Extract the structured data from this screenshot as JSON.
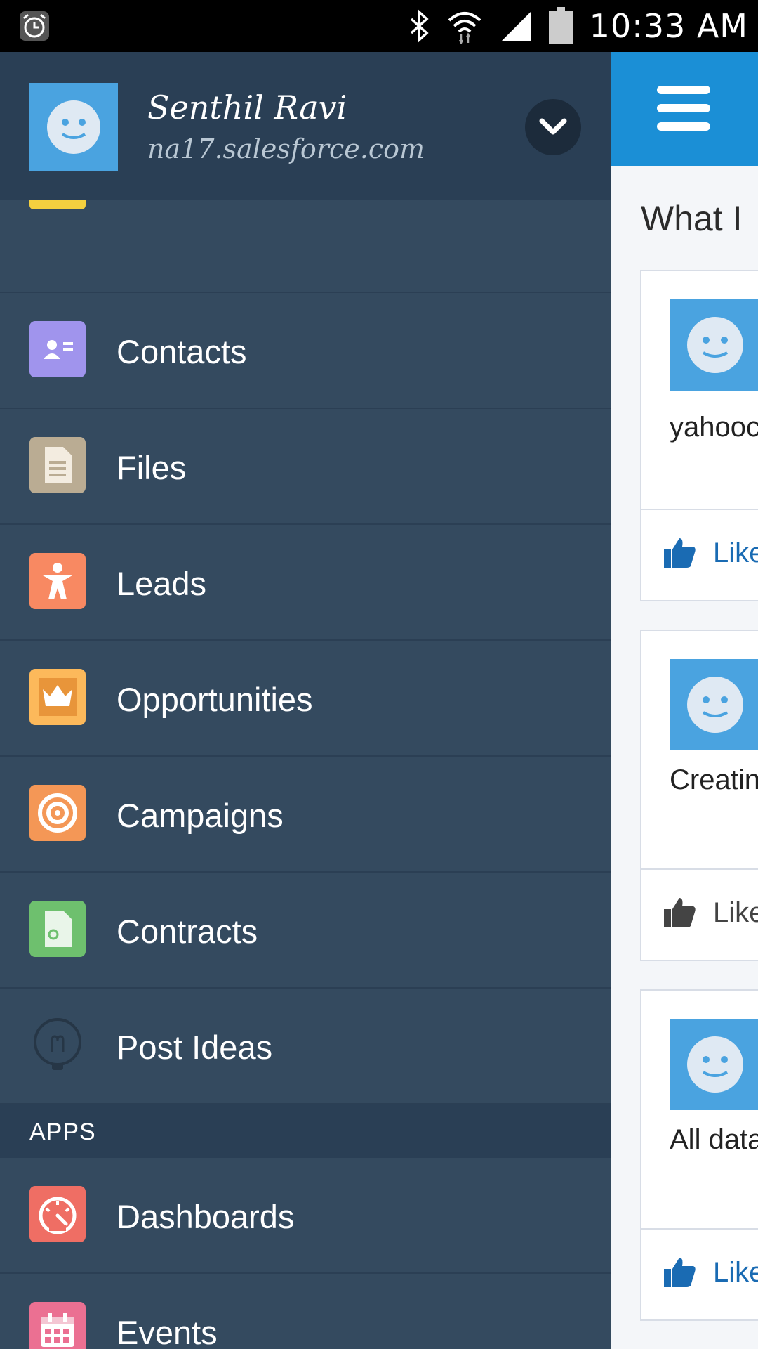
{
  "status_bar": {
    "time": "10:33 AM"
  },
  "drawer": {
    "user": {
      "name": "Senthil Ravi",
      "org": "na17.salesforce.com"
    },
    "items": [
      {
        "label": "Contacts",
        "icon": "contacts-icon",
        "color": "#a094ed"
      },
      {
        "label": "Files",
        "icon": "file-icon",
        "color": "#baac93"
      },
      {
        "label": "Leads",
        "icon": "lead-icon",
        "color": "#f88962"
      },
      {
        "label": "Opportunities",
        "icon": "crown-icon",
        "color": "#fcb95b"
      },
      {
        "label": "Campaigns",
        "icon": "target-icon",
        "color": "#f49756"
      },
      {
        "label": "Contracts",
        "icon": "contract-icon",
        "color": "#6ec06e"
      },
      {
        "label": "Post Ideas",
        "icon": "lightbulb-icon",
        "color": "#2a3a4a"
      }
    ],
    "apps_header": "APPS",
    "apps": [
      {
        "label": "Dashboards",
        "icon": "dashboard-icon",
        "color": "#ef6e64"
      },
      {
        "label": "Events",
        "icon": "calendar-icon",
        "color": "#eb7092"
      }
    ]
  },
  "main": {
    "title": "What I",
    "posts": [
      {
        "text": "yahooc",
        "like": "Like"
      },
      {
        "text": "Creatin",
        "like": "Like"
      },
      {
        "text": "All data",
        "like": "Like"
      }
    ]
  }
}
